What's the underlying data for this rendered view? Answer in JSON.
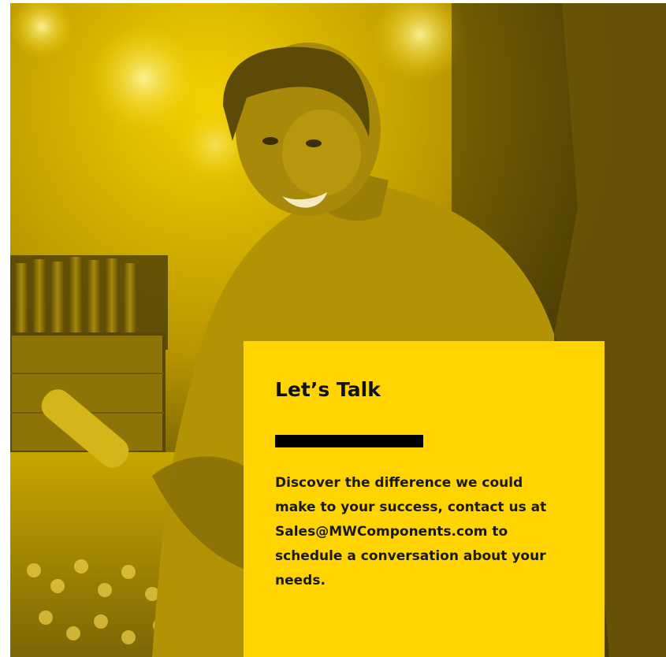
{
  "promo": {
    "title": "Let’s Talk",
    "body": "Discover the difference we could make to your success, contact us at Sales@MWComponents.com to schedule a conversation about your needs."
  },
  "colors": {
    "accent": "#ffd400",
    "photo_tint": "#c9a800",
    "rule": "#000000",
    "text": "#1a1a1a"
  }
}
